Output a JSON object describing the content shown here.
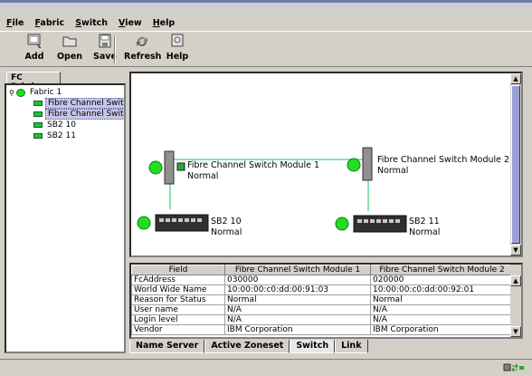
{
  "menu": [
    "File",
    "Fabric",
    "Switch",
    "View",
    "Help"
  ],
  "toolbar": {
    "add": "Add",
    "open": "Open",
    "save": "Save",
    "refresh": "Refresh",
    "help": "Help"
  },
  "left_tab": "FC Fabrics",
  "tree": {
    "fabric": "Fabric 1",
    "items": [
      "Fibre Channel Switch",
      "Fibre Channel Switch",
      "SB2 10",
      "SB2 11"
    ]
  },
  "topology": {
    "switch1": {
      "name": "Fibre Channel Switch Module 1",
      "status": "Normal"
    },
    "switch2": {
      "name": "Fibre Channel Switch Module 2",
      "status": "Normal"
    },
    "blade1": {
      "name": "SB2 10",
      "status": "Normal"
    },
    "blade2": {
      "name": "SB2 11",
      "status": "Normal"
    }
  },
  "grid": {
    "headers": [
      "Field",
      "Fibre Channel Switch Module 1",
      "Fibre Channel Switch Module 2"
    ],
    "rows": [
      [
        "FcAddress",
        "030000",
        "020000"
      ],
      [
        "World Wide Name",
        "10:00:00:c0:dd:00:91:03",
        "10:00:00:c0:dd:00:92:01"
      ],
      [
        "Reason for Status",
        "Normal",
        "Normal"
      ],
      [
        "User name",
        "N/A",
        "N/A"
      ],
      [
        "Login level",
        "N/A",
        "N/A"
      ],
      [
        "Vendor",
        "IBM Corporation",
        "IBM Corporation"
      ]
    ]
  },
  "bottom_tabs": [
    "Name Server",
    "Active Zoneset",
    "Switch",
    "Link"
  ],
  "active_tab": "Switch",
  "colors": {
    "link": "#22c060",
    "node": "#22dd22",
    "selection": "#c6c6e8",
    "thumb": "#9a9fd6"
  }
}
